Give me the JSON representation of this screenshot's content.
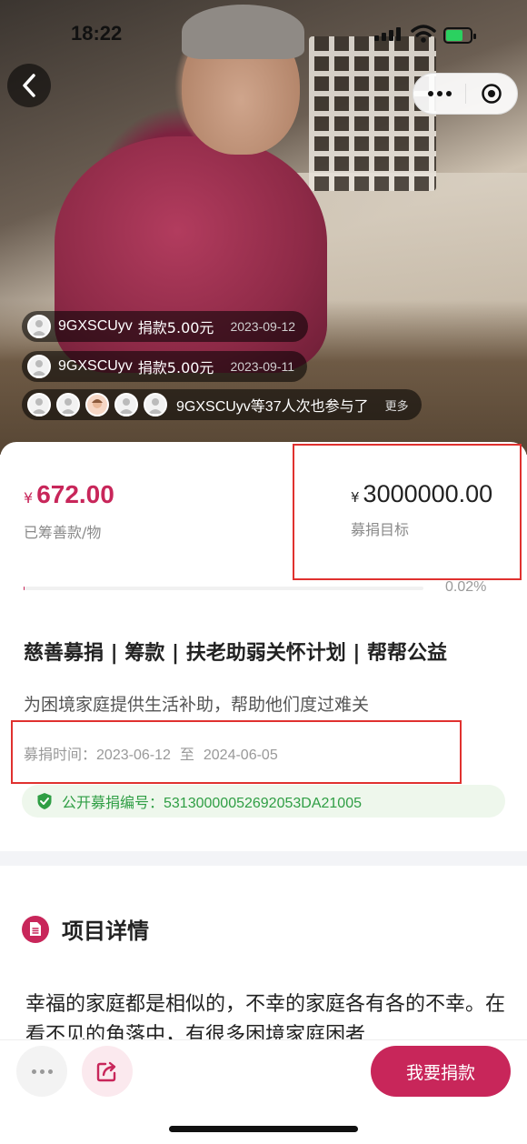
{
  "status_bar": {
    "time": "18:22"
  },
  "donations": [
    {
      "name": "9GXSCUyv",
      "action": "捐款5.00元",
      "date": "2023-09-12"
    },
    {
      "name": "9GXSCUyv",
      "action": "捐款5.00元",
      "date": "2023-09-11"
    }
  ],
  "participants": {
    "text": "9GXSCUyv等37人次也参与了",
    "more": "更多"
  },
  "stats": {
    "currency": "¥",
    "raised": "672.00",
    "raised_label": "已筹善款/物",
    "goal": "3000000.00",
    "goal_label": "募捐目标",
    "progress_percent": "0.02%",
    "progress_value": 0.02
  },
  "project": {
    "title": "慈善募捐 | 筹款 | 扶老助弱关怀计划 | 帮帮公益",
    "subtitle": "为困境家庭提供生活补助，帮助他们度过难关",
    "period_label": "募捐时间：",
    "period_start": "2023-06-12",
    "period_sep": "至",
    "period_end": "2024-06-05",
    "registration": "公开募捐编号：53130000052692053DA21005"
  },
  "details": {
    "heading": "项目详情",
    "text": "幸福的家庭都是相似的，不幸的家庭各有各的不幸。在看不见的角落中，有很多困境家庭困者"
  },
  "bottom": {
    "donate_label": "我要捐款"
  },
  "colors": {
    "accent": "#c8265a",
    "verify_green": "#2f9e44",
    "highlight_red": "#e0312f"
  }
}
